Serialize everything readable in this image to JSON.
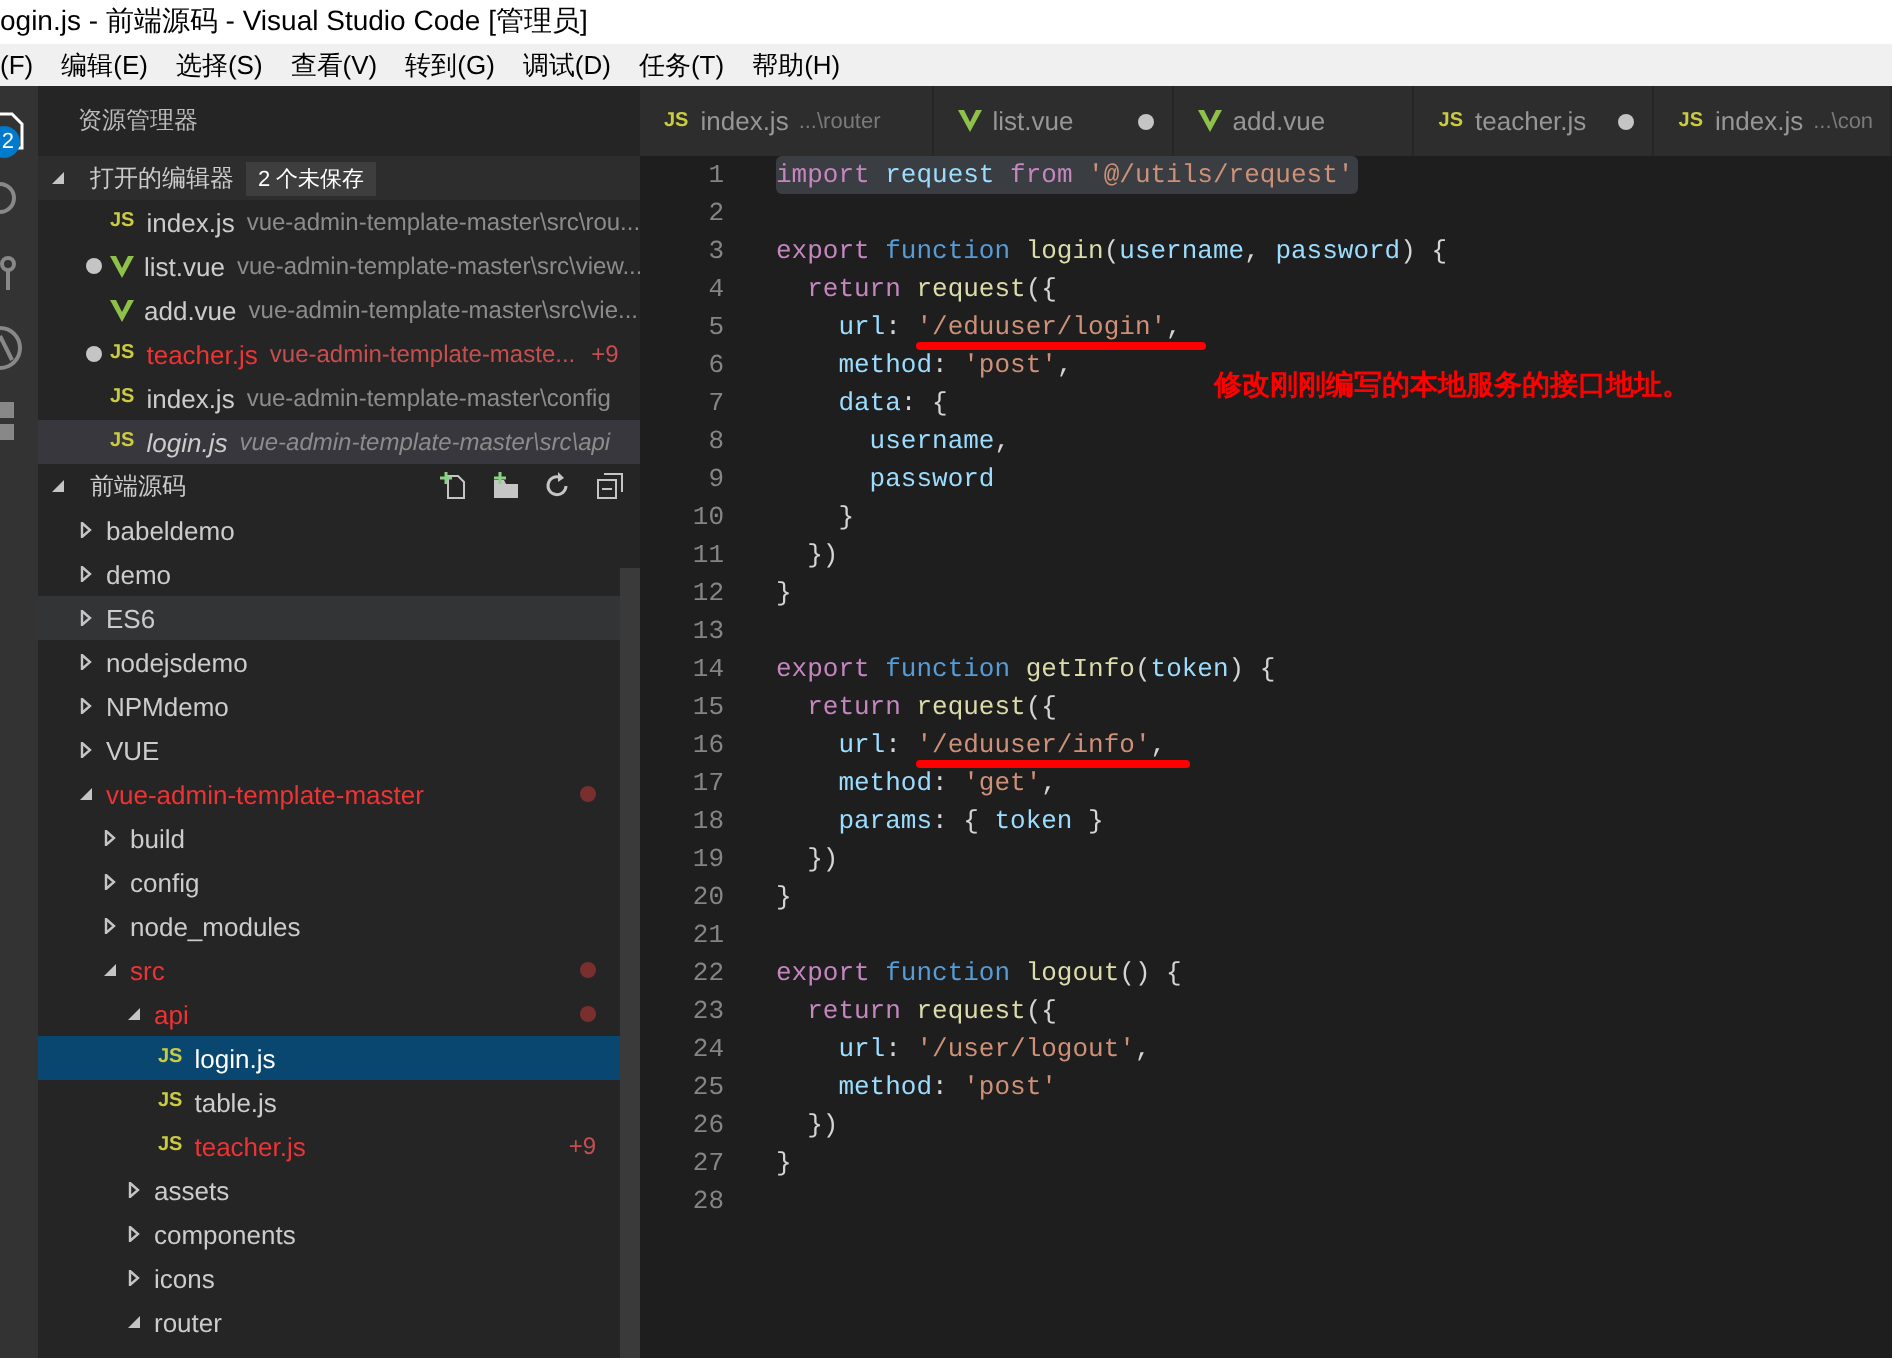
{
  "window": {
    "title": "ogin.js - 前端源码 - Visual Studio Code [管理员]"
  },
  "menu": [
    "(F)",
    "编辑(E)",
    "选择(S)",
    "查看(V)",
    "转到(G)",
    "调试(D)",
    "任务(T)",
    "帮助(H)"
  ],
  "activity_bar": {
    "badge": "2"
  },
  "sidebar": {
    "title": "资源管理器",
    "open_editors": {
      "title": "打开的编辑器",
      "badge": "2 个未保存",
      "expanded": true,
      "items": [
        {
          "kind": "js",
          "icon_label": "JS",
          "name": "index.js",
          "path": "vue-admin-template-master\\src\\rou...",
          "dirty": false,
          "modified": false,
          "selected": false,
          "preview": false
        },
        {
          "kind": "vue",
          "name": "list.vue",
          "path": "vue-admin-template-master\\src\\view...",
          "dirty": true,
          "modified": false,
          "selected": false,
          "preview": false
        },
        {
          "kind": "vue",
          "name": "add.vue",
          "path": "vue-admin-template-master\\src\\vie...",
          "dirty": false,
          "modified": false,
          "selected": false,
          "preview": false
        },
        {
          "kind": "js",
          "icon_label": "JS",
          "name": "teacher.js",
          "path": "vue-admin-template-maste...",
          "dirty": true,
          "modified": true,
          "selected": false,
          "preview": false,
          "problems": "+9"
        },
        {
          "kind": "js",
          "icon_label": "JS",
          "name": "index.js",
          "path": "vue-admin-template-master\\config",
          "dirty": false,
          "modified": false,
          "selected": false,
          "preview": false
        },
        {
          "kind": "js",
          "icon_label": "JS",
          "name": "login.js",
          "path": "vue-admin-template-master\\src\\api",
          "dirty": false,
          "modified": false,
          "selected": true,
          "preview": true
        }
      ]
    },
    "folder": {
      "title": "前端源码",
      "expanded": true,
      "tree": [
        {
          "kind": "folder",
          "name": "babeldemo",
          "expanded": false,
          "modified": false,
          "selected": false,
          "hovered": false
        },
        {
          "kind": "folder",
          "name": "demo",
          "expanded": false,
          "modified": false,
          "selected": false,
          "hovered": false
        },
        {
          "kind": "folder",
          "name": "ES6",
          "expanded": false,
          "modified": false,
          "selected": false,
          "hovered": true
        },
        {
          "kind": "folder",
          "name": "nodejsdemo",
          "expanded": false,
          "modified": false,
          "selected": false,
          "hovered": false
        },
        {
          "kind": "folder",
          "name": "NPMdemo",
          "expanded": false,
          "modified": false,
          "selected": false,
          "hovered": false
        },
        {
          "kind": "folder",
          "name": "VUE",
          "expanded": false,
          "modified": false,
          "selected": false,
          "hovered": false
        },
        {
          "kind": "folder",
          "name": "vue-admin-template-master",
          "expanded": true,
          "modified": true,
          "selected": false,
          "hovered": false,
          "children": [
            {
              "kind": "folder",
              "name": "build",
              "expanded": false,
              "modified": false,
              "selected": false,
              "hovered": false
            },
            {
              "kind": "folder",
              "name": "config",
              "expanded": false,
              "modified": false,
              "selected": false,
              "hovered": false
            },
            {
              "kind": "folder",
              "name": "node_modules",
              "expanded": false,
              "modified": false,
              "selected": false,
              "hovered": false
            },
            {
              "kind": "folder",
              "name": "src",
              "expanded": true,
              "modified": true,
              "selected": false,
              "hovered": false,
              "children": [
                {
                  "kind": "folder",
                  "name": "api",
                  "expanded": true,
                  "modified": true,
                  "selected": false,
                  "hovered": false,
                  "children": [
                    {
                      "kind": "js",
                      "icon_label": "JS",
                      "name": "login.js",
                      "modified": false,
                      "selected": true,
                      "hovered": false
                    },
                    {
                      "kind": "js",
                      "icon_label": "JS",
                      "name": "table.js",
                      "modified": false,
                      "selected": false,
                      "hovered": false
                    },
                    {
                      "kind": "js",
                      "icon_label": "JS",
                      "name": "teacher.js",
                      "modified": true,
                      "selected": false,
                      "hovered": false,
                      "problems": "+9"
                    }
                  ]
                },
                {
                  "kind": "folder",
                  "name": "assets",
                  "expanded": false,
                  "modified": false,
                  "selected": false,
                  "hovered": false
                },
                {
                  "kind": "folder",
                  "name": "components",
                  "expanded": false,
                  "modified": false,
                  "selected": false,
                  "hovered": false
                },
                {
                  "kind": "folder",
                  "name": "icons",
                  "expanded": false,
                  "modified": false,
                  "selected": false,
                  "hovered": false
                },
                {
                  "kind": "folder",
                  "name": "router",
                  "expanded": true,
                  "modified": false,
                  "selected": false,
                  "hovered": false
                }
              ]
            }
          ]
        }
      ]
    }
  },
  "tabs": [
    {
      "kind": "js",
      "icon_label": "JS",
      "name": "index.js",
      "hint": "...\\router",
      "dirty": false,
      "selected": false
    },
    {
      "kind": "vue",
      "name": "list.vue",
      "dirty": true,
      "selected": false
    },
    {
      "kind": "vue",
      "name": "add.vue",
      "dirty": false,
      "selected": false
    },
    {
      "kind": "js",
      "icon_label": "JS",
      "name": "teacher.js",
      "dirty": true,
      "selected": false
    },
    {
      "kind": "js",
      "icon_label": "JS",
      "name": "index.js",
      "hint": "...\\con",
      "dirty": false,
      "selected": false
    }
  ],
  "editor": {
    "lines": [
      {
        "number": "1",
        "decorations": [
          {
            "kind": "selection"
          }
        ],
        "tokens": [
          {
            "kind": "kw",
            "text": "import"
          },
          {
            "kind": "var",
            "text": " request"
          },
          {
            "kind": "kw",
            "text": " from"
          },
          {
            "kind": "str",
            "text": " '@/utils/request'"
          }
        ]
      },
      {
        "number": "2"
      },
      {
        "number": "3",
        "tokens": [
          {
            "kind": "kw",
            "text": "export"
          },
          {
            "kind": "dec",
            "text": " function"
          },
          {
            "kind": "fn",
            "text": " login"
          },
          {
            "kind": "p",
            "text": "("
          },
          {
            "kind": "var",
            "text": "username"
          },
          {
            "kind": "p",
            "text": ","
          },
          {
            "kind": "var",
            "text": " password"
          },
          {
            "kind": "p",
            "text": ") {"
          }
        ]
      },
      {
        "number": "4",
        "tokens": [
          {
            "kind": "kw",
            "text": "  return"
          },
          {
            "kind": "fn",
            "text": " request"
          },
          {
            "kind": "p",
            "text": "({"
          }
        ]
      },
      {
        "number": "5",
        "decorations": [
          {
            "kind": "underline"
          }
        ],
        "tokens": [
          {
            "kind": "var",
            "text": "    url"
          },
          {
            "kind": "p",
            "text": ":"
          },
          {
            "kind": "str",
            "text": " '/eduuser/login'"
          },
          {
            "kind": "p",
            "text": ","
          }
        ]
      },
      {
        "number": "6",
        "tokens": [
          {
            "kind": "var",
            "text": "    method"
          },
          {
            "kind": "p",
            "text": ":"
          },
          {
            "kind": "str",
            "text": " 'post'"
          },
          {
            "kind": "p",
            "text": ","
          }
        ]
      },
      {
        "number": "7",
        "tokens": [
          {
            "kind": "var",
            "text": "    data"
          },
          {
            "kind": "p",
            "text": ": {"
          }
        ]
      },
      {
        "number": "8",
        "tokens": [
          {
            "kind": "var",
            "text": "      username"
          },
          {
            "kind": "p",
            "text": ","
          }
        ]
      },
      {
        "number": "9",
        "tokens": [
          {
            "kind": "var",
            "text": "      password"
          }
        ]
      },
      {
        "number": "10",
        "tokens": [
          {
            "kind": "p",
            "text": "    }"
          }
        ]
      },
      {
        "number": "11",
        "tokens": [
          {
            "kind": "p",
            "text": "  })"
          }
        ]
      },
      {
        "number": "12",
        "tokens": [
          {
            "kind": "p",
            "text": "}"
          }
        ]
      },
      {
        "number": "13"
      },
      {
        "number": "14",
        "tokens": [
          {
            "kind": "kw",
            "text": "export"
          },
          {
            "kind": "dec",
            "text": " function"
          },
          {
            "kind": "fn",
            "text": " getInfo"
          },
          {
            "kind": "p",
            "text": "("
          },
          {
            "kind": "var",
            "text": "token"
          },
          {
            "kind": "p",
            "text": ") {"
          }
        ]
      },
      {
        "number": "15",
        "tokens": [
          {
            "kind": "kw",
            "text": "  return"
          },
          {
            "kind": "fn",
            "text": " request"
          },
          {
            "kind": "p",
            "text": "({"
          }
        ]
      },
      {
        "number": "16",
        "decorations": [
          {
            "kind": "underline"
          }
        ],
        "tokens": [
          {
            "kind": "var",
            "text": "    url"
          },
          {
            "kind": "p",
            "text": ":"
          },
          {
            "kind": "str",
            "text": " '/eduuser/info'"
          },
          {
            "kind": "p",
            "text": ","
          }
        ]
      },
      {
        "number": "17",
        "tokens": [
          {
            "kind": "var",
            "text": "    method"
          },
          {
            "kind": "p",
            "text": ":"
          },
          {
            "kind": "str",
            "text": " 'get'"
          },
          {
            "kind": "p",
            "text": ","
          }
        ]
      },
      {
        "number": "18",
        "tokens": [
          {
            "kind": "var",
            "text": "    params"
          },
          {
            "kind": "p",
            "text": ": {"
          },
          {
            "kind": "var",
            "text": " token"
          },
          {
            "kind": "p",
            "text": " }"
          }
        ]
      },
      {
        "number": "19",
        "tokens": [
          {
            "kind": "p",
            "text": "  })"
          }
        ]
      },
      {
        "number": "20",
        "tokens": [
          {
            "kind": "p",
            "text": "}"
          }
        ]
      },
      {
        "number": "21"
      },
      {
        "number": "22",
        "tokens": [
          {
            "kind": "kw",
            "text": "export"
          },
          {
            "kind": "dec",
            "text": " function"
          },
          {
            "kind": "fn",
            "text": " logout"
          },
          {
            "kind": "p",
            "text": "() {"
          }
        ]
      },
      {
        "number": "23",
        "tokens": [
          {
            "kind": "kw",
            "text": "  return"
          },
          {
            "kind": "fn",
            "text": " request"
          },
          {
            "kind": "p",
            "text": "({"
          }
        ]
      },
      {
        "number": "24",
        "tokens": [
          {
            "kind": "var",
            "text": "    url"
          },
          {
            "kind": "p",
            "text": ":"
          },
          {
            "kind": "str",
            "text": " '/user/logout'"
          },
          {
            "kind": "p",
            "text": ","
          }
        ]
      },
      {
        "number": "25",
        "tokens": [
          {
            "kind": "var",
            "text": "    method"
          },
          {
            "kind": "p",
            "text": ":"
          },
          {
            "kind": "str",
            "text": " 'post'"
          }
        ]
      },
      {
        "number": "26",
        "tokens": [
          {
            "kind": "p",
            "text": "  })"
          }
        ]
      },
      {
        "number": "27",
        "tokens": [
          {
            "kind": "p",
            "text": "}"
          }
        ]
      },
      {
        "number": "28"
      }
    ],
    "annotation": "修改刚刚编写的本地服务的接口地址。"
  }
}
